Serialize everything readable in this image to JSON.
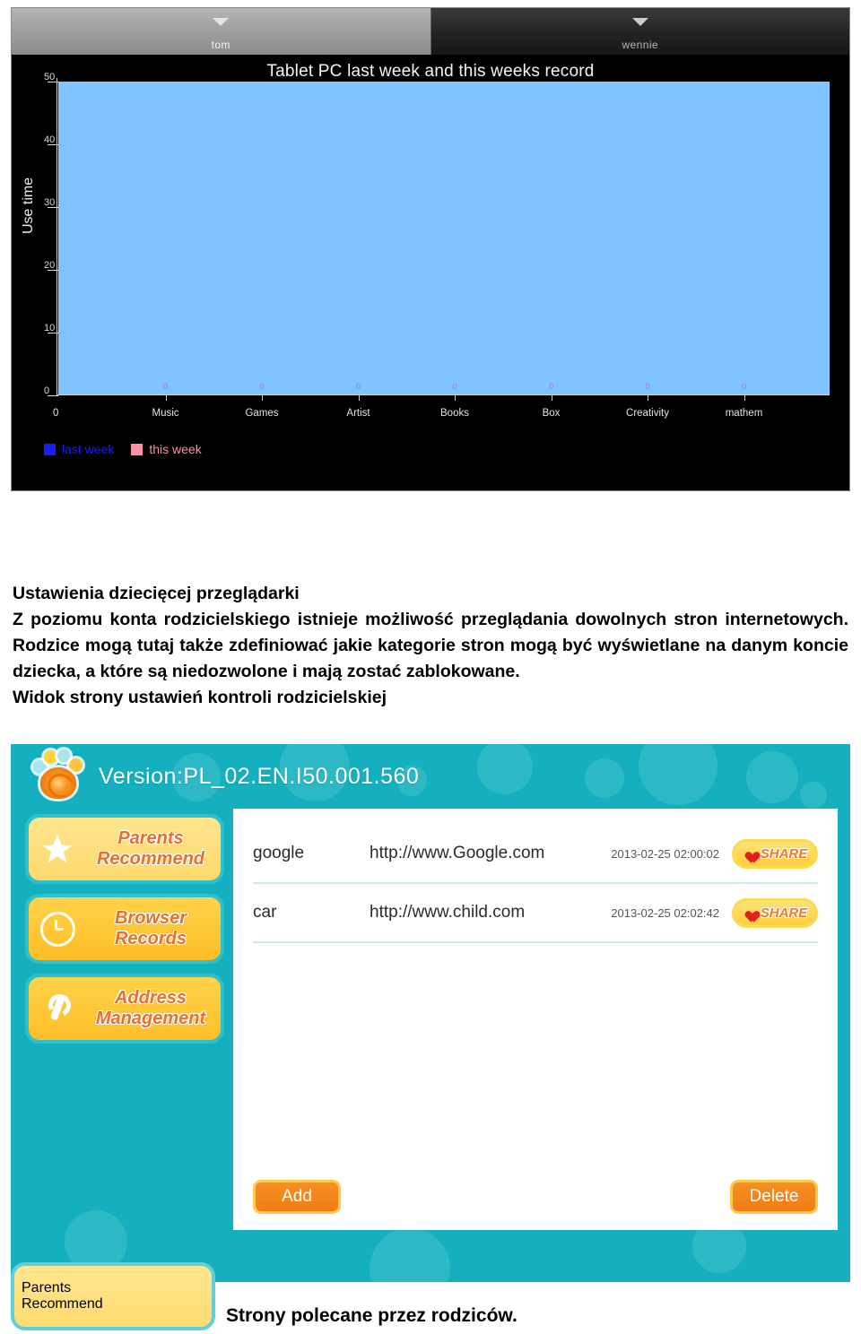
{
  "tablet_screenshot": {
    "tabs": [
      {
        "label": "tom",
        "state": "active",
        "caret": "chevron-down-icon"
      },
      {
        "label": "wennie",
        "state": "inactive",
        "caret": "chevron-down-icon"
      }
    ],
    "colors": {
      "plot_fill": "#80c4ff",
      "background": "#000000",
      "last_week": "#1b1bff",
      "this_week": "#ff8fa6",
      "data_label": "#b46bd8"
    }
  },
  "chart_data": {
    "type": "bar",
    "title": "Tablet PC last week and this weeks record",
    "xlabel": "",
    "ylabel": "Use time",
    "categories": [
      "Music",
      "Games",
      "Artist",
      "Books",
      "Box",
      "Creativity",
      "mathem"
    ],
    "series": [
      {
        "name": "last week",
        "values": [
          0,
          0,
          0,
          0,
          0,
          0,
          0
        ],
        "color": "#1b1bff"
      },
      {
        "name": "this week",
        "values": [
          0,
          0,
          0,
          0,
          0,
          0,
          0
        ],
        "color": "#ff8fa6"
      }
    ],
    "data_labels": [
      "0",
      "0",
      "0",
      "0",
      "0",
      "0",
      "0"
    ],
    "ylim": [
      0,
      50
    ],
    "yticks": [
      0,
      10,
      20,
      30,
      40,
      50
    ],
    "ytick_labels": [
      "0",
      "10",
      "20",
      "30",
      "40",
      "50"
    ],
    "origin_label": "0",
    "grid": false,
    "legend_position": "bottom-left",
    "legend": [
      "last week",
      "this week"
    ]
  },
  "article": {
    "heading": "Ustawienia dziecięcej przeglądarki",
    "paragraph": "Z poziomu konta rodzicielskiego istnieje możliwość przeglądania dowolnych stron internetowych. Rodzice mogą tutaj także zdefiniować jakie kategorie stron mogą być wyświetlane na danym koncie dziecka, a które są niedozwolone i mają zostać zablokowane.",
    "caption": "Widok strony ustawień kontroli rodzicielskiej"
  },
  "kids_app": {
    "logo_icon": "paw-logo-icon",
    "version": "Version:PL_02.EN.I50.001.560",
    "sidebar": [
      {
        "label_line1": "Parents",
        "label_line2": "Recommend",
        "icon": "star-icon",
        "selected": true
      },
      {
        "label_line1": "Browser",
        "label_line2": "Records",
        "icon": "clock-icon",
        "selected": false
      },
      {
        "label_line1": "Address",
        "label_line2": "Management",
        "icon": "wrench-icon",
        "selected": false
      }
    ],
    "records": [
      {
        "name": "google",
        "url": "http://www.Google.com",
        "time": "2013-02-25 02:00:02",
        "share_label": "SHARE",
        "share_icon": "heart-icon"
      },
      {
        "name": "car",
        "url": "http://www.child.com",
        "time": "2013-02-25 02:02:42",
        "share_label": "SHARE",
        "share_icon": "heart-icon"
      }
    ],
    "footer_buttons": {
      "add": "Add",
      "delete": "Delete"
    },
    "colors": {
      "teal": "#15b0bf",
      "yellow": "#ffd24a",
      "orange": "#f07c1e"
    }
  },
  "bottom_caption": {
    "button": {
      "label_line1": "Parents",
      "label_line2": "Recommend",
      "icon": "star-icon"
    },
    "text": "Strony polecane przez rodziców."
  }
}
